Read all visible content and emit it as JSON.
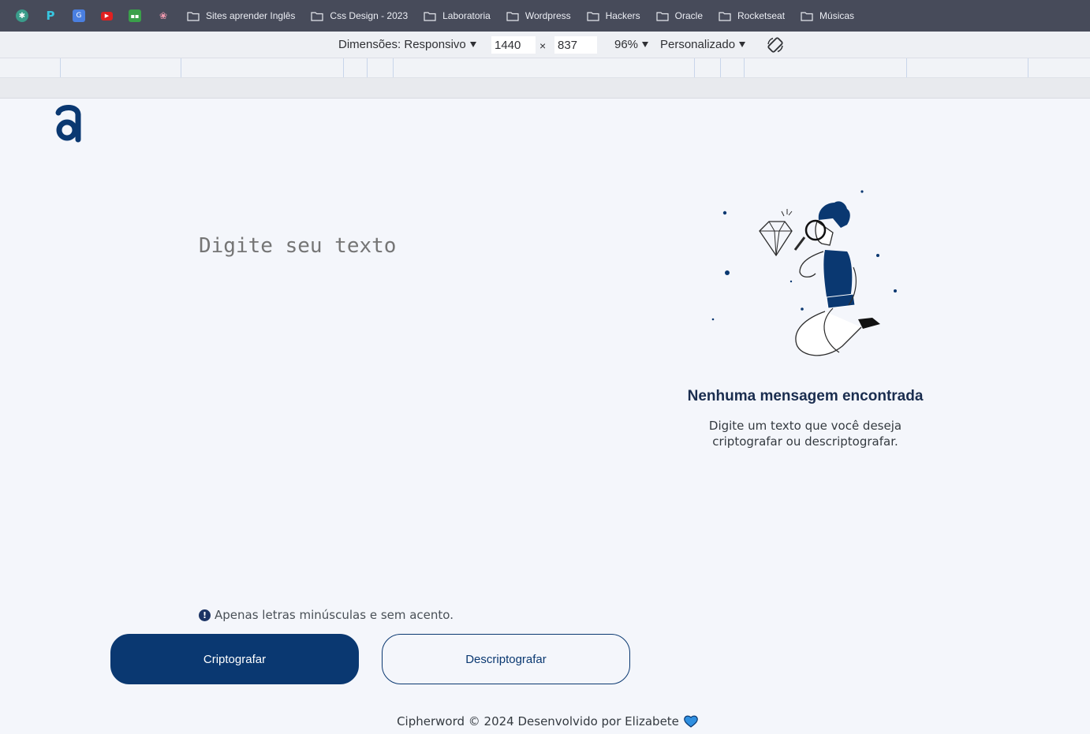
{
  "bookmarks": {
    "folders": [
      "Sites aprender Inglês",
      "Css Design - 2023",
      "Laboratoria",
      "Wordpress",
      "Hackers",
      "Oracle",
      "Rocketseat",
      "Músicas"
    ]
  },
  "device_toolbar": {
    "dimensions_label": "Dimensões: Responsivo",
    "width_value": "1440",
    "times": "×",
    "height_value": "837",
    "zoom": "96%",
    "throttle": "Personalizado"
  },
  "app": {
    "textarea_placeholder": "Digite seu texto",
    "hint": "Apenas letras minúsculas e sem acento.",
    "hint_icon": "!",
    "encrypt_label": "Criptografar",
    "decrypt_label": "Descriptografar",
    "result_title": "Nenhuma mensagem encontrada",
    "result_text": "Digite um texto que você deseja criptografar ou descriptografar.",
    "footer": "Cipherword © 2024 Desenvolvido por Elizabete",
    "colors": {
      "primary": "#0a3871",
      "background": "#f4f6fb"
    }
  }
}
